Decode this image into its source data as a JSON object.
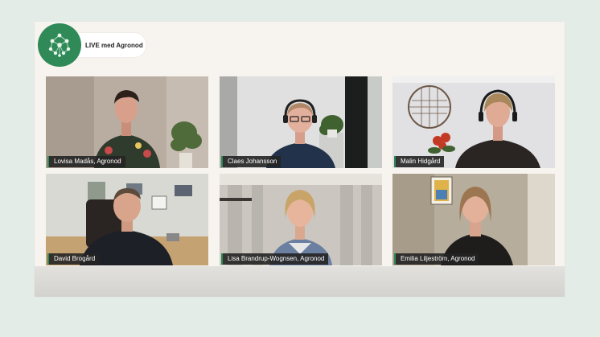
{
  "event": {
    "live_label": "LIVE med Agronod",
    "logo_icon": "agronod-network-icon",
    "brand_color": "#2f8a57"
  },
  "participants": [
    {
      "name": "Lovisa Madås, Agronod"
    },
    {
      "name": "Claes Johansson"
    },
    {
      "name": "Malin Hidgård"
    },
    {
      "name": "David Brogård"
    },
    {
      "name": "Lisa Brandrup-Wognsen, Agronod"
    },
    {
      "name": "Emilia Liljeström, Agronod"
    }
  ]
}
